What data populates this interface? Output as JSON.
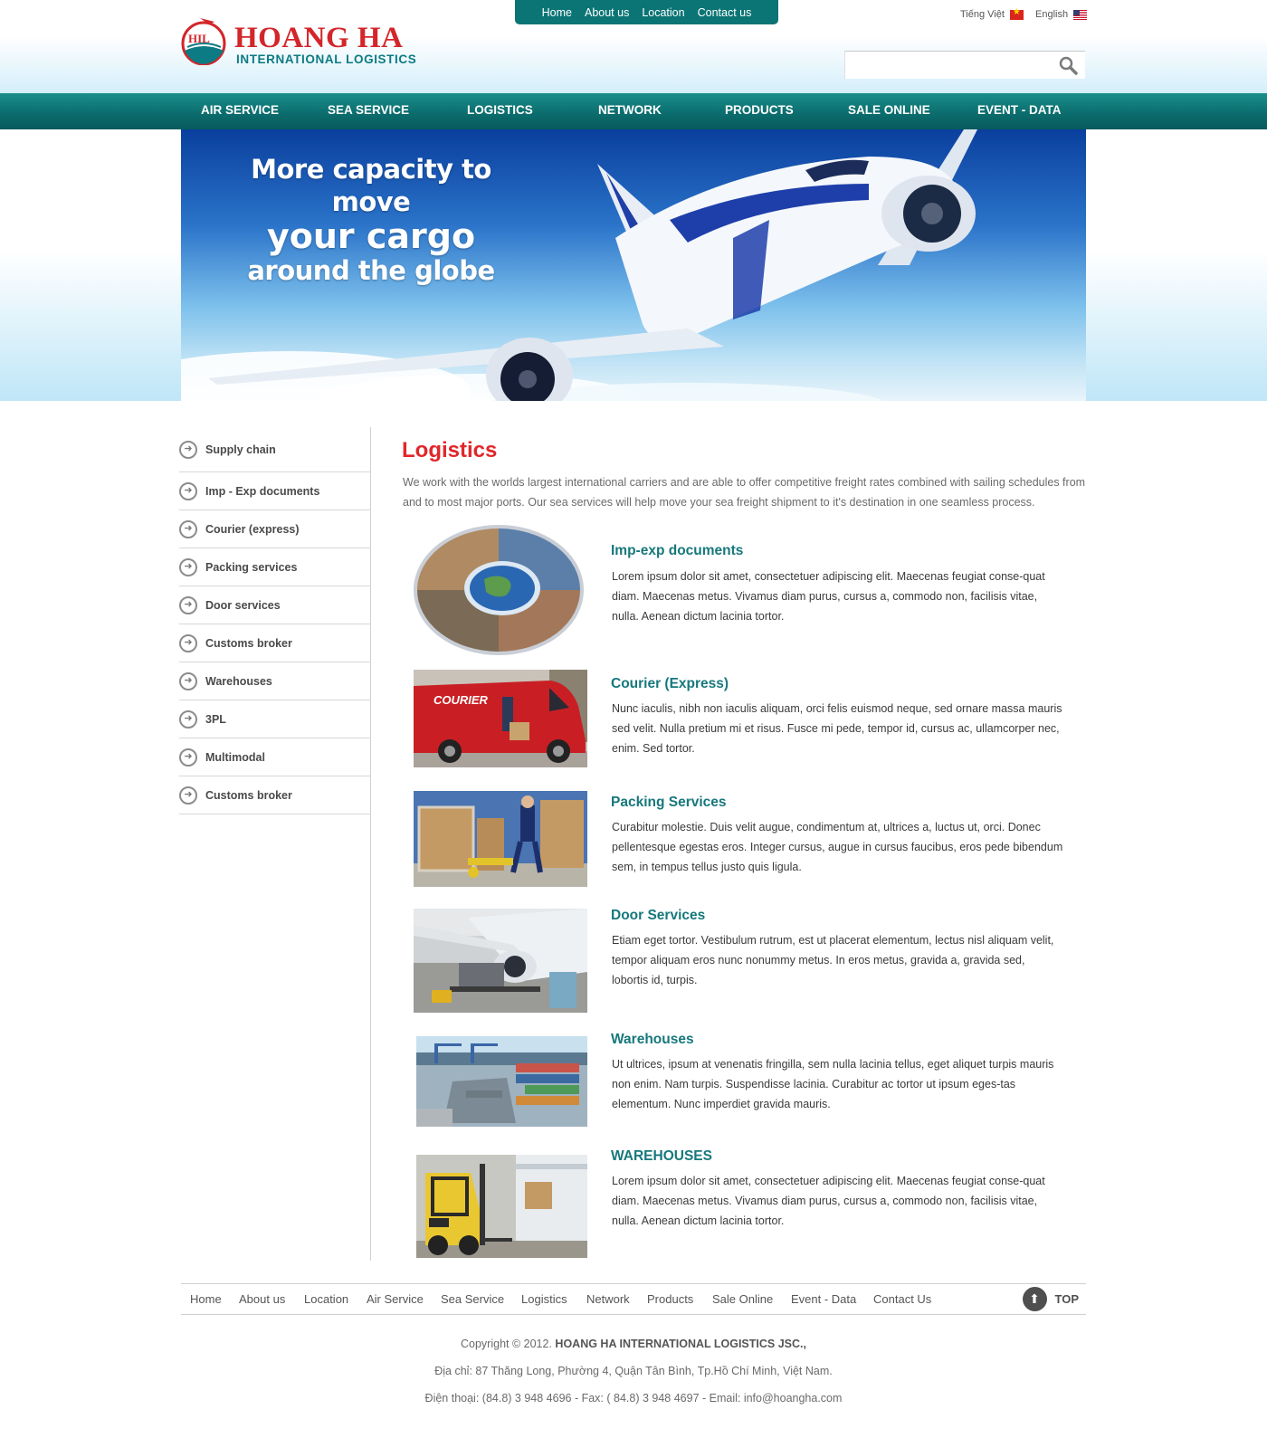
{
  "logo": {
    "name": "HOANG HA",
    "subtitle": "INTERNATIONAL LOGISTICS",
    "mark": "HIL"
  },
  "top_menu": [
    "Home",
    "About us",
    "Location",
    "Contact us"
  ],
  "languages": [
    {
      "label": "Tiếng Việt",
      "flag": "vietnam-flag-icon"
    },
    {
      "label": "English",
      "flag": "us-flag-icon"
    }
  ],
  "search": {
    "placeholder": "",
    "icon": "search-icon"
  },
  "main_nav": [
    "AIR SERVICE",
    "SEA SERVICE",
    "LOGISTICS",
    "NETWORK",
    "PRODUCTS",
    "SALE ONLINE",
    "EVENT - DATA"
  ],
  "banner": {
    "line1": "More capacity to move",
    "line2": "your cargo",
    "line3": "around the globe"
  },
  "sidebar": [
    "Supply chain",
    "Imp - Exp documents",
    "Courier (express)",
    "Packing services",
    "Door services",
    "Customs broker",
    "Warehouses",
    "3PL",
    "Multimodal",
    "Customs broker"
  ],
  "content": {
    "title": "Logistics",
    "intro": "We work with the worlds largest international carriers and are able to offer competitive freight rates combined with sailing schedules from and to most major ports. Our sea services will help move your sea freight shipment to it's destination in one seamless process.",
    "services": [
      {
        "title": "Imp-exp documents",
        "text": "Lorem ipsum dolor sit amet, consectetuer adipiscing elit. Maecenas feugiat conse-quat diam. Maecenas metus. Vivamus diam purus, cursus a, commodo non, facilisis vitae, nulla. Aenean dictum lacinia tortor."
      },
      {
        "title": "Courier (Express)",
        "text": "Nunc iaculis, nibh non iaculis aliquam, orci felis euismod neque, sed ornare massa mauris sed velit. Nulla pretium mi et risus. Fusce mi pede, tempor id, cursus ac, ullamcorper nec, enim. Sed tortor.",
        "image_text": "COURIER"
      },
      {
        "title": "Packing Services",
        "text": "Curabitur molestie. Duis velit augue, condimentum at, ultrices a, luctus ut, orci. Donec pellentesque egestas eros. Integer cursus, augue in cursus faucibus, eros pede bibendum sem, in tempus tellus justo quis ligula."
      },
      {
        "title": "Door Services",
        "text": "Etiam eget tortor. Vestibulum rutrum, est ut placerat elementum, lectus nisl aliquam velit, tempor aliquam eros nunc nonummy metus. In eros metus, gravida a, gravida sed, lobortis id, turpis."
      },
      {
        "title": "Warehouses",
        "text": "Ut ultrices, ipsum at venenatis fringilla, sem nulla lacinia tellus, eget aliquet turpis mauris non enim. Nam turpis. Suspendisse lacinia. Curabitur ac tortor ut ipsum eges-tas elementum. Nunc imperdiet gravida mauris."
      },
      {
        "title": "WAREHOUSES",
        "text": "Lorem ipsum dolor sit amet, consectetuer adipiscing elit. Maecenas feugiat conse-quat diam. Maecenas metus. Vivamus diam purus, cursus a, commodo non, facilisis vitae, nulla. Aenean dictum lacinia tortor."
      }
    ]
  },
  "footer": {
    "links": [
      "Home",
      "About us",
      "Location",
      "Air Service",
      "Sea Service",
      "Logistics",
      "Network",
      "Products",
      "Sale Online",
      "Event - Data",
      "Contact Us"
    ],
    "top_label": "TOP",
    "copyright_prefix": "Copyright © 2012.",
    "company": "HOANG HA INTERNATIONAL LOGISTICS JSC.,",
    "address": "Địa chỉ: 87 Thăng Long, Phường 4, Quận Tân Bình, Tp.Hồ Chí Minh, Việt Nam.",
    "contact": "Điện thoại: (84.8) 3 948 4696 - Fax: ( 84.8) 3 948 4697 - Email: info@hoangha.com"
  },
  "colors": {
    "brand_red": "#e0262b",
    "teal": "#0b7475",
    "heading_teal": "#16787c"
  }
}
